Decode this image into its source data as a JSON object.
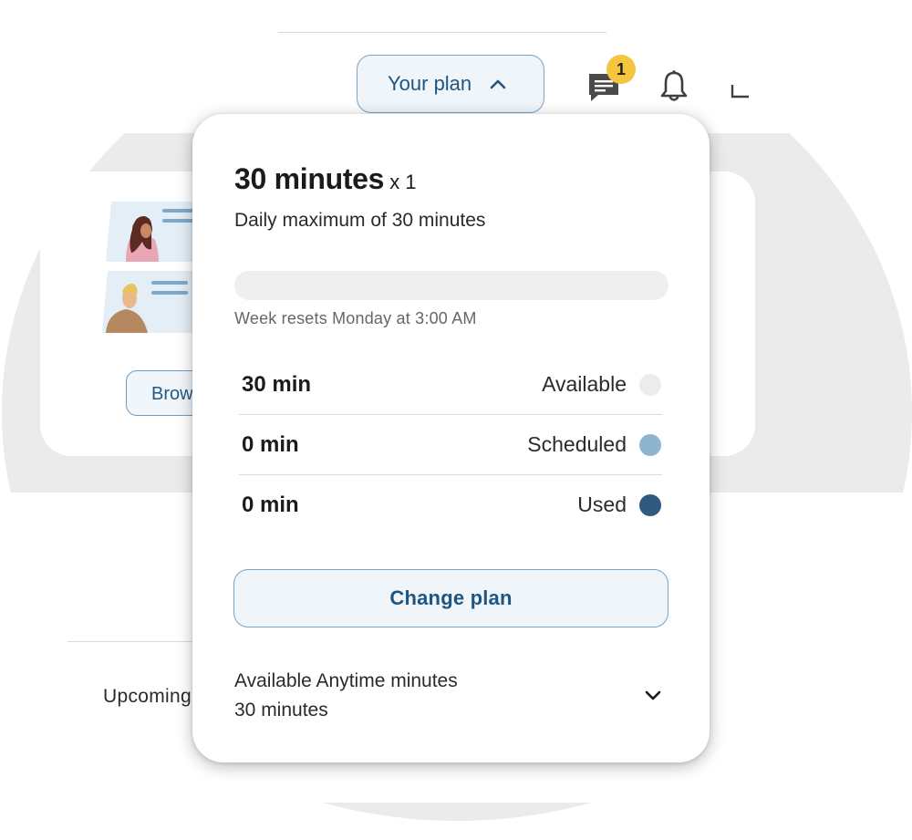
{
  "header": {
    "plan_button_label": "Your plan",
    "message_badge_count": "1"
  },
  "background": {
    "browse_label": "Browse",
    "upcoming_label": "Upcoming"
  },
  "plan_popover": {
    "title": "30 minutes",
    "multiplier": "x 1",
    "subtitle": "Daily maximum of 30 minutes",
    "usage_fraction": 0,
    "reset_note": "Week resets Monday at 3:00 AM",
    "rows": [
      {
        "value": "30 min",
        "label": "Available",
        "dot_color": "#ececec"
      },
      {
        "value": "0 min",
        "label": "Scheduled",
        "dot_color": "#8eb4cf"
      },
      {
        "value": "0 min",
        "label": "Used",
        "dot_color": "#2e5a80"
      }
    ],
    "change_plan_label": "Change plan",
    "anytime": {
      "title": "Available Anytime minutes",
      "value": "30 minutes"
    }
  },
  "colors": {
    "accent_text": "#1f5681",
    "button_border": "#7ba3c3",
    "button_fill": "#f0f5f9",
    "badge": "#f5c63d"
  }
}
